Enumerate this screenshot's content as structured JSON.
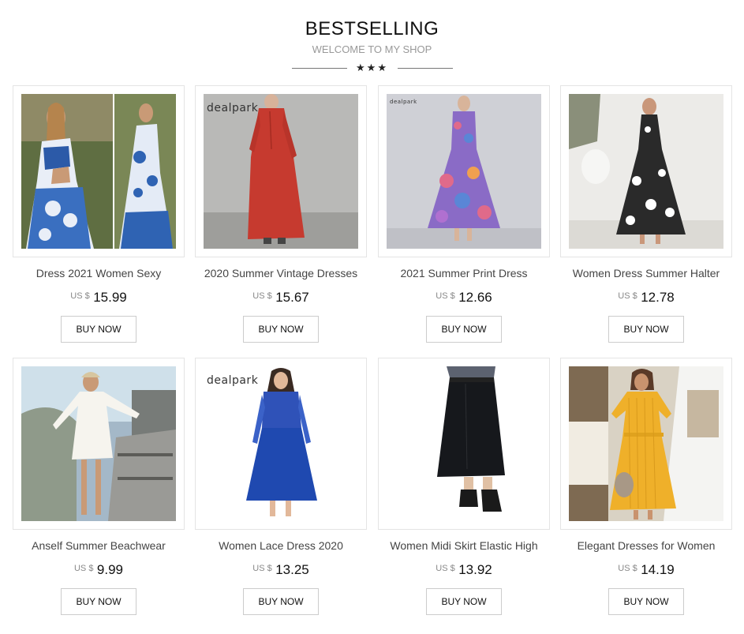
{
  "header": {
    "title": "BESTSELLING",
    "subtitle": "WELCOME TO MY SHOP",
    "stars": "★★★"
  },
  "currency_label": "US $",
  "buy_label": "BUY NOW",
  "products": [
    {
      "name": "Dress 2021 Women Sexy",
      "price": "15.99",
      "image": "blue-tile-print-halter-dress"
    },
    {
      "name": "2020 Summer Vintage Dresses",
      "price": "15.67",
      "image": "red-long-sleeve-maxi-dress"
    },
    {
      "name": "2021 Summer Print Dress",
      "price": "12.66",
      "image": "purple-floral-maxi-dress"
    },
    {
      "name": "Women Dress Summer Halter",
      "price": "12.78",
      "image": "black-white-floral-halter-dress"
    },
    {
      "name": "Anself Summer Beachwear",
      "price": "9.99",
      "image": "white-lace-beach-coverup"
    },
    {
      "name": "Women Lace Dress 2020",
      "price": "13.25",
      "image": "royal-blue-lace-dress"
    },
    {
      "name": "Women Midi Skirt Elastic High",
      "price": "13.92",
      "image": "black-midi-skirt"
    },
    {
      "name": "Elegant Dresses for Women",
      "price": "14.19",
      "image": "yellow-belted-dress"
    }
  ],
  "watermarks": {
    "p2": "dealpark",
    "p3": "dealpark",
    "p6": "dealpark"
  }
}
